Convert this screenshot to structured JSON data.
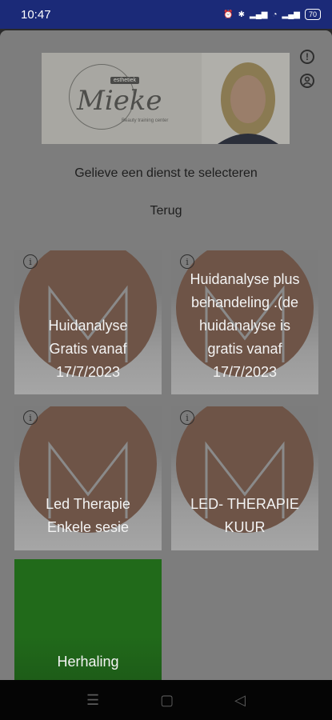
{
  "status_bar": {
    "time": "10:47",
    "battery": "70"
  },
  "banner": {
    "logo_tag": "esthetiek",
    "logo_name": "Mieke",
    "logo_sub": "Beauty training center"
  },
  "page": {
    "select_label": "Gelieve een dienst te selecteren",
    "back_label": "Terug"
  },
  "cards": [
    {
      "title_lines": [
        "Huidanalyse",
        "Gratis vanaf",
        "17/7/2023"
      ]
    },
    {
      "title_lines": [
        "Huidanalyse plus",
        "behandeling .(de",
        "huidanalyse is",
        "gratis vanaf",
        "17/7/2023"
      ]
    },
    {
      "title_lines": [
        "Led Therapie",
        "Enkele sesie"
      ]
    },
    {
      "title_lines": [
        "LED- THERAPIE",
        "KUUR"
      ]
    },
    {
      "title_lines": [
        "Herhaling"
      ]
    }
  ],
  "colors": {
    "status_bar": "#1b2a78",
    "card_circle": "#6e5447",
    "green_card": "#216a1a"
  }
}
